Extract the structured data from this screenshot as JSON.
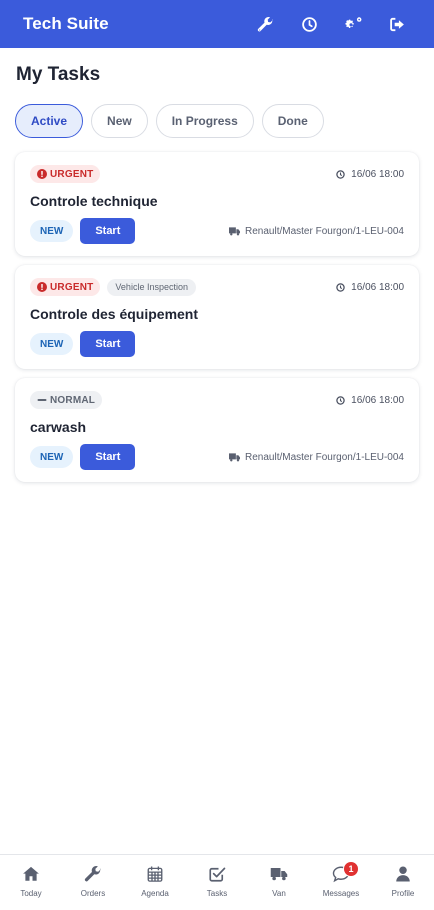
{
  "header": {
    "title": "Tech Suite",
    "icons": [
      "wrench-icon",
      "clock-icon",
      "gears-icon",
      "sign-out-icon"
    ]
  },
  "page": {
    "title": "My Tasks"
  },
  "filters": [
    {
      "label": "Active",
      "active": true
    },
    {
      "label": "New",
      "active": false
    },
    {
      "label": "In Progress",
      "active": false
    },
    {
      "label": "Done",
      "active": false
    }
  ],
  "tasks": [
    {
      "priority": "URGENT",
      "tag": "",
      "due": "16/06 18:00",
      "title": "Controle technique",
      "status": "NEW",
      "action": "Start",
      "vehicle": "Renault/Master Fourgon/1-LEU-004"
    },
    {
      "priority": "URGENT",
      "tag": "Vehicle Inspection",
      "due": "16/06 18:00",
      "title": "Controle des équipement",
      "status": "NEW",
      "action": "Start",
      "vehicle": ""
    },
    {
      "priority": "NORMAL",
      "tag": "",
      "due": "16/06 18:00",
      "title": "carwash",
      "status": "NEW",
      "action": "Start",
      "vehicle": "Renault/Master Fourgon/1-LEU-004"
    }
  ],
  "nav": [
    {
      "label": "Today",
      "icon": "home-icon"
    },
    {
      "label": "Orders",
      "icon": "wrench-icon"
    },
    {
      "label": "Agenda",
      "icon": "calendar-icon"
    },
    {
      "label": "Tasks",
      "icon": "checkbox-icon"
    },
    {
      "label": "Van",
      "icon": "truck-icon"
    },
    {
      "label": "Messages",
      "icon": "chat-icon",
      "badge": "1"
    },
    {
      "label": "Profile",
      "icon": "user-icon"
    }
  ],
  "colors": {
    "primary": "#3b5bdb",
    "urgent": "#c92a2a",
    "badge": "#e03131"
  }
}
